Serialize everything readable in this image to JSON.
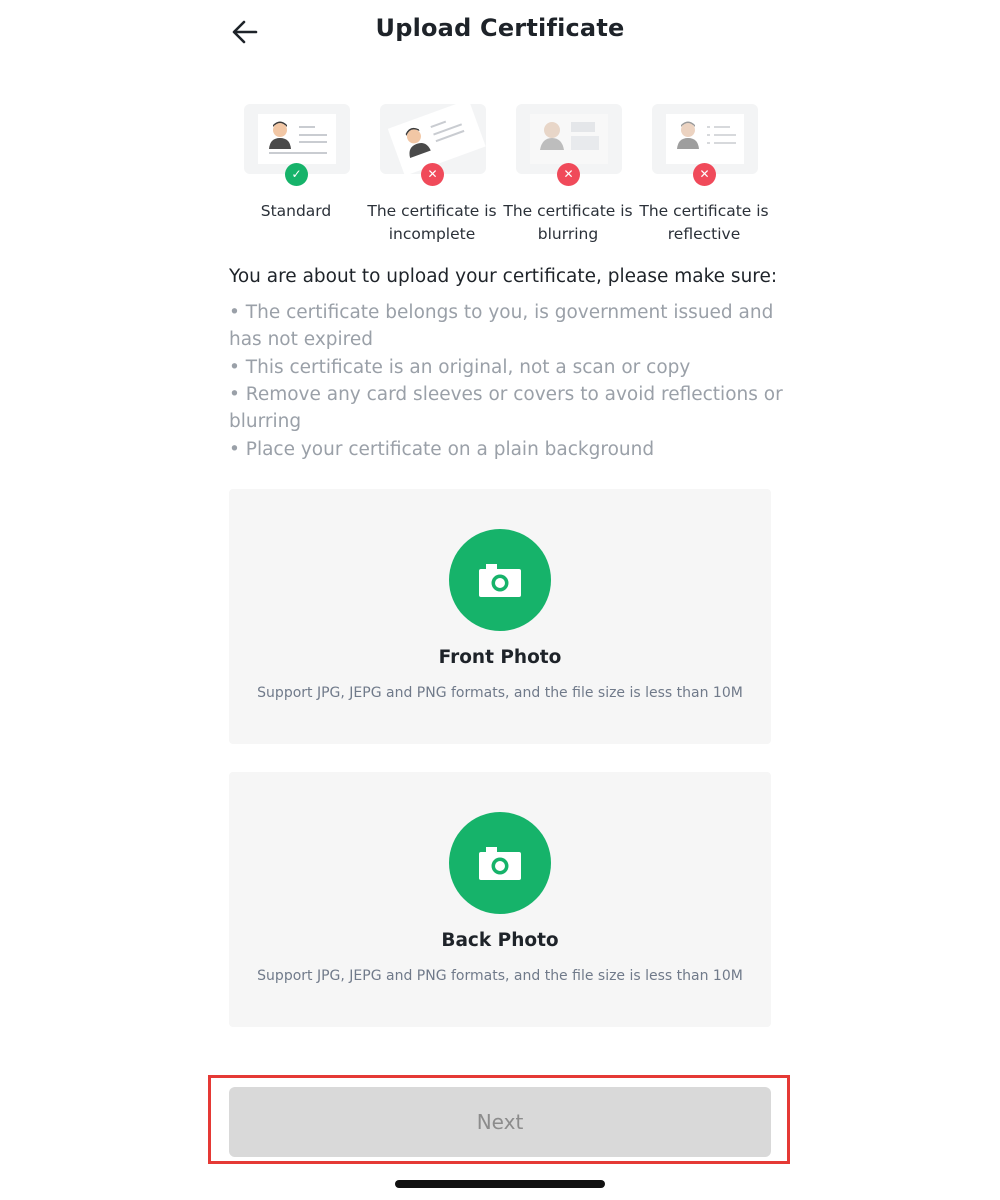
{
  "header": {
    "title": "Upload Certificate",
    "back_icon": "arrow-left-icon"
  },
  "examples": [
    {
      "label": "Standard",
      "status": "valid",
      "status_icon": "check-icon"
    },
    {
      "label": "The certificate is incomplete",
      "status": "invalid",
      "status_icon": "close-icon"
    },
    {
      "label": "The certificate is blurring",
      "status": "invalid",
      "status_icon": "close-icon"
    },
    {
      "label": "The certificate is reflective",
      "status": "invalid",
      "status_icon": "close-icon"
    }
  ],
  "guidelines": {
    "intro": "You are about to upload your certificate, please make sure:",
    "items": [
      "• The certificate belongs to you, is government issued and has not expired",
      "• This certificate is an original, not a scan or copy",
      " • Remove any card sleeves or covers to avoid reflections or blurring",
      "• Place your certificate on a plain background"
    ]
  },
  "uploads": {
    "front": {
      "title": "Front Photo",
      "description": "Support JPG, JEPG and PNG formats, and the file size is less than 10M",
      "icon": "camera-icon"
    },
    "back": {
      "title": "Back Photo",
      "description": "Support JPG, JEPG and PNG formats, and the file size is less than 10M",
      "icon": "camera-icon"
    }
  },
  "footer": {
    "next_label": "Next",
    "next_enabled": false
  },
  "colors": {
    "accent_green": "#16b36a",
    "error_red": "#f04a5a",
    "highlight_red": "#e53935",
    "disabled_button": "#d9d9d9"
  }
}
